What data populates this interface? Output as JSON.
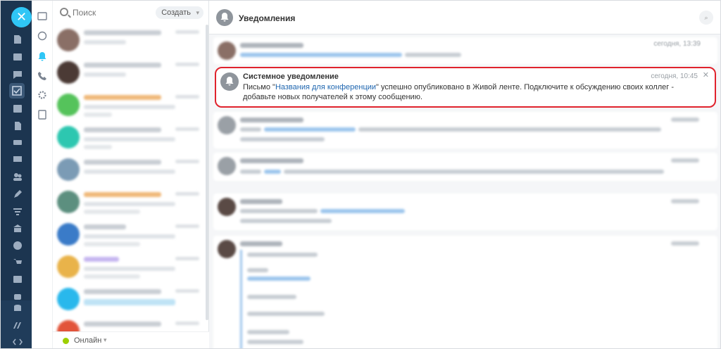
{
  "rail": {
    "close_icon": "close-icon"
  },
  "search": {
    "placeholder": "Поиск"
  },
  "create_button": "Создать",
  "status": {
    "label": "Онлайн"
  },
  "header": {
    "title": "Уведомления"
  },
  "notification": {
    "sender": "Системное уведомление",
    "time": "сегодня, 10:45",
    "text_before": "Письмо \"",
    "link": "Названия для конференции",
    "text_after": "\" успешно опубликовано в Живой ленте. Подключите к обсуждению своих коллег - добавьте новых получателей к этому сообщению."
  },
  "first_note_time": "сегодня, 13:39",
  "colors": {
    "rail": "#1c3550",
    "accent": "#2fc6f6",
    "highlight_border": "#e0232d",
    "online": "#9dcf00",
    "link": "#2067b0"
  }
}
